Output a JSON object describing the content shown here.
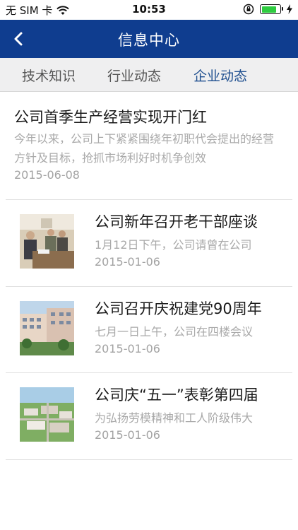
{
  "status_bar": {
    "carrier": "无 SIM 卡",
    "time": "10:53",
    "battery_level": 0.8,
    "icons": [
      "wifi-icon",
      "rotation-lock-icon",
      "battery-icon",
      "charging-icon"
    ]
  },
  "nav": {
    "title": "信息中心",
    "back_icon": "chevron-left-icon"
  },
  "tabs": [
    {
      "label": "技术知识",
      "active": false
    },
    {
      "label": "行业动态",
      "active": false
    },
    {
      "label": "企业动态",
      "active": true
    }
  ],
  "featured": {
    "title": "公司首季生产经营实现开门红",
    "summary": "今年以来，公司上下紧紧围绕年初职代会提出的经营方针及目标，抢抓市场利好时机争创效",
    "date": "2015-06-08"
  },
  "items": [
    {
      "title": "公司新年召开老干部座谈",
      "summary": "1月12日下午，公司请曾在公司",
      "date": "2015-01-06",
      "thumb": "meeting-photo"
    },
    {
      "title": "公司召开庆祝建党90周年",
      "summary": "七月一日上午，公司在四楼会议",
      "date": "2015-01-06",
      "thumb": "building-photo"
    },
    {
      "title": "公司庆“五一”表彰第四届",
      "summary": "为弘扬劳模精神和工人阶级伟大",
      "date": "2015-01-06",
      "thumb": "campus-aerial-photo"
    }
  ],
  "colors": {
    "nav_bg": "#0f3d8f",
    "tab_bg": "#efeff0",
    "tab_active": "#1f4f8f",
    "muted_text": "#a9a9a9"
  }
}
